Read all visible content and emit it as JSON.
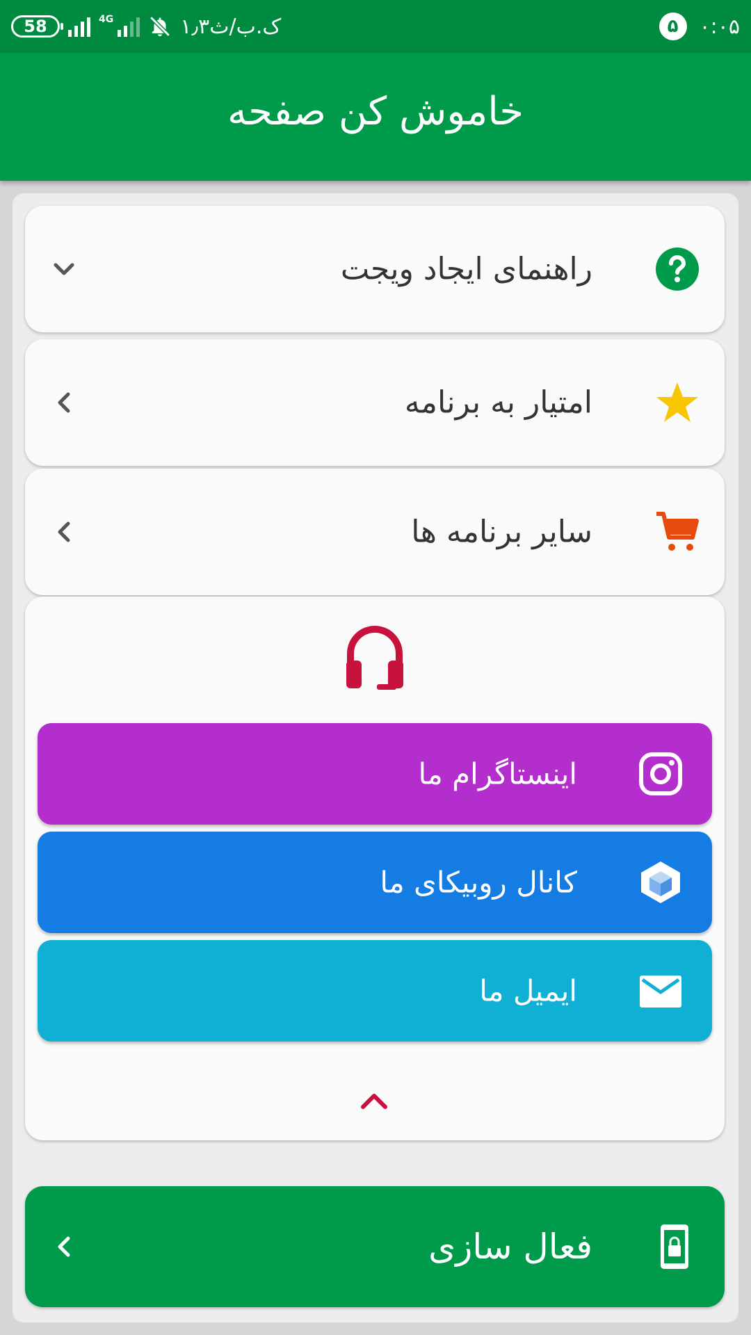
{
  "status_bar": {
    "battery": "58",
    "network_type": "4G",
    "data_speed": "۱٫۳ک.ب/ث",
    "notification_count": "۵",
    "time": "۰:۰۵"
  },
  "app_bar": {
    "title": "خاموش کن صفحه"
  },
  "menu": {
    "widget_guide": "راهنمای ایجاد ویجت",
    "rate_app": "امتیار به برنامه",
    "other_apps": "سایر برنامه ها"
  },
  "support": {
    "instagram": "اینستاگرام ما",
    "rubika": "کانال روبیکای ما",
    "email": "ایمیل ما"
  },
  "activate": {
    "label": "فعال سازی"
  },
  "colors": {
    "primary_green": "#009b4a",
    "status_bar_green": "#008a3f",
    "instagram_purple": "#b42ecd",
    "rubika_blue": "#157ce4",
    "email_cyan": "#10b0d4",
    "support_red": "#c8123e",
    "star_yellow": "#f7c600",
    "cart_orange": "#e64a0c"
  },
  "icons": {
    "help": "question-circle-icon",
    "rate": "star-icon",
    "other_apps": "shopping-cart-icon",
    "support": "headset-icon",
    "instagram": "instagram-icon",
    "rubika": "rubika-cube-icon",
    "email": "envelope-icon",
    "activate": "phone-lock-icon"
  }
}
